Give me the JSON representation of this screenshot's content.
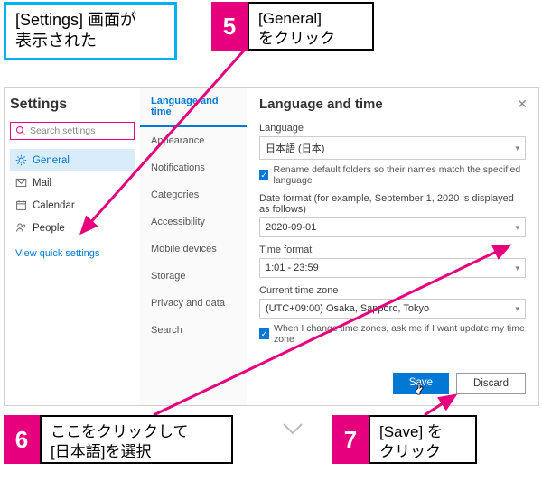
{
  "callouts": {
    "c1": "[Settings] 画面が\n表示された",
    "c5_num": "5",
    "c5_text": "[General]\nをクリック",
    "c6_num": "6",
    "c6_text": "ここをクリックして\n[日本語]を選択",
    "c7_num": "7",
    "c7_text": "[Save] を\nクリック"
  },
  "settings": {
    "title": "Settings",
    "search_placeholder": "Search settings",
    "nav": {
      "general": "General",
      "mail": "Mail",
      "calendar": "Calendar",
      "people": "People",
      "quick": "View quick settings"
    },
    "col2": {
      "lang_time": "Language and time",
      "appearance": "Appearance",
      "notifications": "Notifications",
      "categories": "Categories",
      "accessibility": "Accessibility",
      "mobile": "Mobile devices",
      "storage": "Storage",
      "privacy": "Privacy and data",
      "search": "Search"
    },
    "pane": {
      "title": "Language and time",
      "lang_label": "Language",
      "lang_value": "日本語 (日本)",
      "chk1": "Rename default folders so their names match the specified language",
      "datefmt_label": "Date format (for example, September 1, 2020 is displayed as follows)",
      "datefmt_value": "2020-09-01",
      "timefmt_label": "Time format",
      "timefmt_value": "1:01 - 23:59",
      "tz_label": "Current time zone",
      "tz_value": "(UTC+09:00) Osaka, Sapporo, Tokyo",
      "chk2": "When I change time zones, ask me if I want update my time zone",
      "save": "Save",
      "discard": "Discard"
    }
  }
}
